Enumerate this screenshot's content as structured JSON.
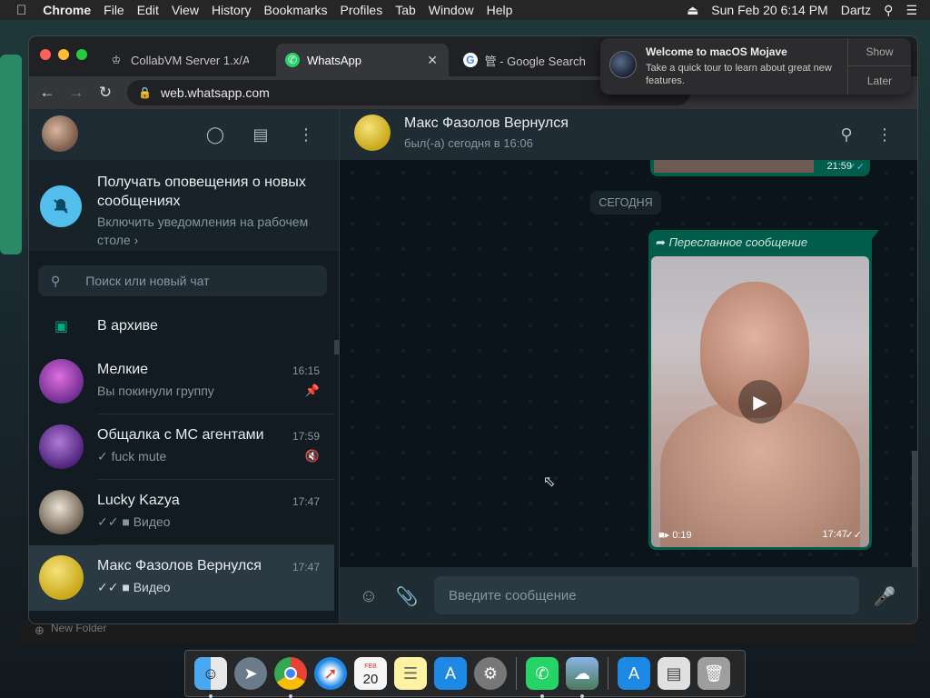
{
  "menubar": {
    "app": "Chrome",
    "items": [
      "File",
      "Edit",
      "View",
      "History",
      "Bookmarks",
      "Profiles",
      "Tab",
      "Window",
      "Help"
    ],
    "datetime": "Sun Feb 20  6:14 PM",
    "user": "Dartz"
  },
  "browser": {
    "tabs": [
      {
        "title": "CollabVM Server 1.x/Ac",
        "icon": "collabvm-icon"
      },
      {
        "title": "WhatsApp",
        "icon": "whatsapp-icon"
      },
      {
        "title": "管 - Google Search",
        "icon": "google-icon"
      }
    ],
    "url": "web.whatsapp.com"
  },
  "notification": {
    "title": "Welcome to macOS Mojave",
    "body": "Take a quick tour to learn about great new features.",
    "show_label": "Show",
    "later_label": "Later"
  },
  "sidebar": {
    "notify_title": "Получать оповещения о новых сообщениях",
    "notify_body": "Включить уведомления на рабочем столе ›",
    "search_placeholder": "Поиск или новый чат",
    "archive_label": "В архиве",
    "chats": [
      {
        "name": "Мелкие",
        "time": "16:15",
        "preview": "Вы покинули группу",
        "badge": "pin-icon",
        "avatar_color": "#9b4fb0"
      },
      {
        "name": "Общалка с МС агентами",
        "time": "17:59",
        "preview": "✓ fuck mute",
        "badge": "muted-icon",
        "avatar_color": "#7b3fa3"
      },
      {
        "name": "Lucky Kazya",
        "time": "17:47",
        "preview": "✓✓ ■ Видео",
        "badge": "",
        "avatar_color": "#c9c3b8"
      },
      {
        "name": "Макс Фазолов Вернулся",
        "time": "17:47",
        "preview": "✓✓ ■ Видео",
        "badge": "",
        "avatar_color": "#d6b92a"
      }
    ]
  },
  "conversation": {
    "name": "Макс Фазолов Вернулся",
    "status": "был(-а) сегодня в 16:06",
    "prev_time": "21:59",
    "date_label": "СЕГОДНЯ",
    "forwarded_label": "Пересланное сообщение",
    "video_duration": "0:19",
    "video_time": "17:47",
    "input_placeholder": "Введите сообщение"
  },
  "background": {
    "new_folder": "New Folder"
  },
  "dock": {
    "apps": [
      "finder-icon",
      "launchpad-icon",
      "chrome-icon",
      "safari-icon",
      "calendar-icon",
      "notes-icon",
      "app-store-icon",
      "system-preferences-icon",
      "whatsapp-icon",
      "preview-icon",
      "downloads-folder-icon",
      "documents-icon",
      "trash-icon"
    ],
    "calendar_day": "20",
    "calendar_month": "FEB"
  },
  "colors": {
    "accent": "#00a884",
    "outgoing_bubble": "#005c4b",
    "panel": "#202c33",
    "background": "#111b21"
  }
}
